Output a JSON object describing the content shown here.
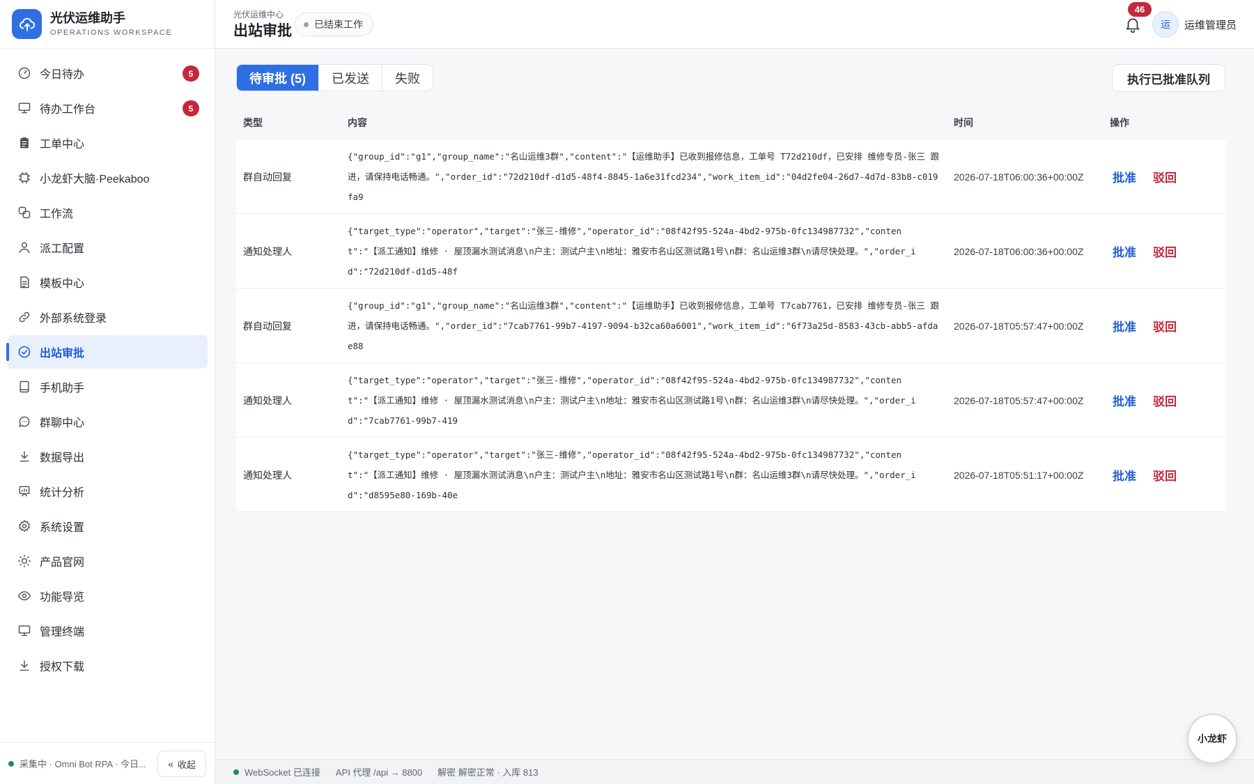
{
  "brand": {
    "title": "光伏运维助手",
    "subtitle": "OPERATIONS WORKSPACE"
  },
  "nav": {
    "items": [
      {
        "label": "今日待办",
        "badge": "5",
        "icon": "dashboard-icon"
      },
      {
        "label": "待办工作台",
        "badge": "5",
        "icon": "monitor-icon"
      },
      {
        "label": "工单中心",
        "icon": "clipboard-icon"
      },
      {
        "label": "小龙虾大脑·Peekaboo",
        "icon": "chip-icon"
      },
      {
        "label": "工作流",
        "icon": "workflow-icon"
      },
      {
        "label": "派工配置",
        "icon": "user-icon"
      },
      {
        "label": "模板中心",
        "icon": "document-icon"
      },
      {
        "label": "外部系统登录",
        "icon": "link-icon"
      },
      {
        "label": "出站审批",
        "icon": "check-circle-icon",
        "active": true
      },
      {
        "label": "手机助手",
        "icon": "tablet-icon"
      },
      {
        "label": "群聊中心",
        "icon": "chat-icon"
      },
      {
        "label": "数据导出",
        "icon": "download-icon"
      },
      {
        "label": "统计分析",
        "icon": "chart-icon"
      },
      {
        "label": "系统设置",
        "icon": "gear-icon"
      },
      {
        "label": "产品官网",
        "icon": "sun-icon"
      },
      {
        "label": "功能导览",
        "icon": "eye-icon"
      },
      {
        "label": "管理终端",
        "icon": "terminal-icon"
      },
      {
        "label": "授权下载",
        "icon": "download-icon"
      }
    ]
  },
  "sidebar_footer": {
    "status": "采集中 · Omni Bot RPA · 今日...",
    "collapse_label": "收起"
  },
  "header": {
    "breadcrumb": "光伏运维中心",
    "title": "出站审批",
    "status": "已结束工作",
    "notification_count": "46",
    "avatar": "运",
    "username": "运维管理员"
  },
  "tabs": [
    {
      "label": "待审批 (5)",
      "active": true
    },
    {
      "label": "已发送"
    },
    {
      "label": "失败"
    }
  ],
  "run_button": "执行已批准队列",
  "table": {
    "headers": {
      "type": "类型",
      "content": "内容",
      "time": "时间",
      "ops": "操作"
    },
    "approve_label": "批准",
    "reject_label": "驳回",
    "rows": [
      {
        "type": "群自动回复",
        "content": "{\"group_id\":\"g1\",\"group_name\":\"名山运维3群\",\"content\":\"【运维助手】已收到报修信息，工单号 T72d210df，已安排 维修专员-张三 跟进，请保持电话畅通。\",\"order_id\":\"72d210df-d1d5-48f4-8845-1a6e31fcd234\",\"work_item_id\":\"04d2fe04-26d7-4d7d-83b8-c019fa9",
        "time": "2026-07-18T06:00:36+00:00Z"
      },
      {
        "type": "通知处理人",
        "content": "{\"target_type\":\"operator\",\"target\":\"张三-维修\",\"operator_id\":\"08f42f95-524a-4bd2-975b-0fc134987732\",\"content\":\"【派工通知】维修 · 屋顶漏水测试消息\\n户主：测试户主\\n地址：雅安市名山区测试路1号\\n群：名山运维3群\\n请尽快处理。\",\"order_id\":\"72d210df-d1d5-48f",
        "time": "2026-07-18T06:00:36+00:00Z"
      },
      {
        "type": "群自动回复",
        "content": "{\"group_id\":\"g1\",\"group_name\":\"名山运维3群\",\"content\":\"【运维助手】已收到报修信息，工单号 T7cab7761，已安排 维修专员-张三 跟进，请保持电话畅通。\",\"order_id\":\"7cab7761-99b7-4197-9094-b32ca60a6001\",\"work_item_id\":\"6f73a25d-8583-43cb-abb5-afdae88",
        "time": "2026-07-18T05:57:47+00:00Z"
      },
      {
        "type": "通知处理人",
        "content": "{\"target_type\":\"operator\",\"target\":\"张三-维修\",\"operator_id\":\"08f42f95-524a-4bd2-975b-0fc134987732\",\"content\":\"【派工通知】维修 · 屋顶漏水测试消息\\n户主：测试户主\\n地址：雅安市名山区测试路1号\\n群：名山运维3群\\n请尽快处理。\",\"order_id\":\"7cab7761-99b7-419",
        "time": "2026-07-18T05:57:47+00:00Z"
      },
      {
        "type": "通知处理人",
        "content": "{\"target_type\":\"operator\",\"target\":\"张三-维修\",\"operator_id\":\"08f42f95-524a-4bd2-975b-0fc134987732\",\"content\":\"【派工通知】维修 · 屋顶漏水测试消息\\n户主：测试户主\\n地址：雅安市名山区测试路1号\\n群：名山运维3群\\n请尽快处理。\",\"order_id\":\"d8595e80-169b-40e",
        "time": "2026-07-18T05:51:17+00:00Z"
      }
    ]
  },
  "statusbar": {
    "ws": "WebSocket 已连接",
    "api": "API 代理 /api → 8800",
    "decrypt": "解密 解密正常 · 入库 813"
  },
  "float_button": "小龙虾",
  "colors": {
    "accent": "#2f6fe4",
    "danger": "#c4283a",
    "success": "#1f8f4e"
  }
}
